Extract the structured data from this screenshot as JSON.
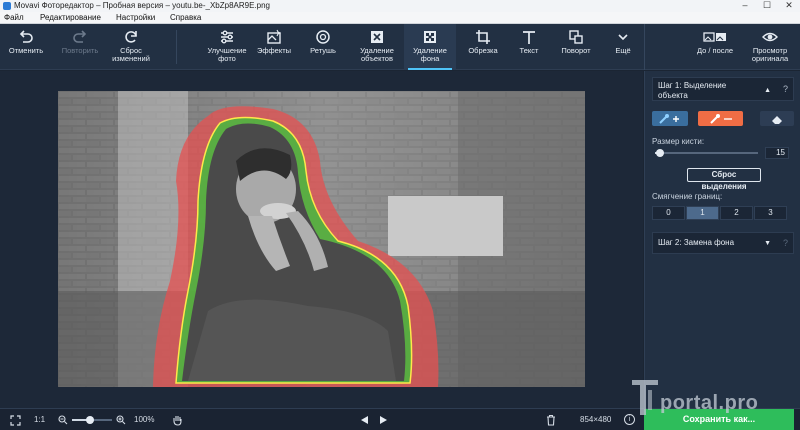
{
  "window": {
    "title": "Movavi Фоторедактор – Пробная версия – youtu.be-_XbZp8AR9E.png",
    "controls": [
      "–",
      "☐",
      "✕"
    ]
  },
  "menu": [
    "Файл",
    "Редактирование",
    "Настройки",
    "Справка"
  ],
  "toolbar": {
    "undo": "Отменить",
    "redo": "Повторить",
    "reset": "Сброс\nизменений",
    "enhance": "Улучшение\nфото",
    "effects": "Эффекты",
    "retouch": "Ретушь",
    "object_removal": "Удаление\nобъектов",
    "bg_removal": "Удаление\nфона",
    "crop": "Обрезка",
    "text": "Текст",
    "rotate": "Поворот",
    "more": "Ещё",
    "before_after": "До / после",
    "view_original": "Просмотр\nоригинала"
  },
  "panel": {
    "step1": "Шаг 1: Выделение\nобъекта",
    "brush_size_label": "Размер кисти:",
    "brush_size_value": "15",
    "brush_size_fraction": 0.05,
    "reset_selection": "Сброс выделения",
    "edge_smoothing_label": "Смягчение границ:",
    "smoothing_options": [
      "0",
      "1",
      "2",
      "3"
    ],
    "smoothing_selected": "1",
    "step2": "Шаг 2: Замена фона",
    "help": "?"
  },
  "status": {
    "fit": "1:1",
    "zoom": "100%",
    "size": "854×480",
    "info": "i",
    "zoom_fraction": 0.45
  },
  "save_button": "Сохранить как...",
  "watermark": "portal.pro",
  "colors": {
    "accent_blue": "#4fc3f7",
    "keep_brush": "#3a6e9e",
    "erase_brush_active": "#f06d45",
    "save_green": "#2ebd5b",
    "mask_red": "#e55050",
    "mask_green": "#3cc03c",
    "outline_yellow": "#ffe84a"
  }
}
